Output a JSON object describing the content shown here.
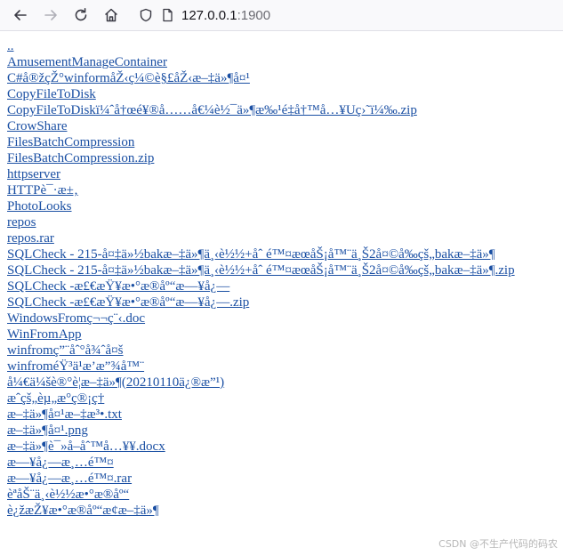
{
  "browser": {
    "url_host": "127.0.0.1",
    "url_port": ":1900"
  },
  "listing": {
    "parent": "..",
    "items": [
      "AmusementManageContainer",
      "C#å®žçŽ°winformåŽ‹ç¼©è§£åŽ‹æ–‡ä»¶å¤¹",
      "CopyFileToDisk",
      "CopyFileToDiskï¼ˆå†œé¥®å……å€¼è½¯ä»¶æ‰¹é‡å†™å…¥Uç›˜ï¼‰.zip",
      "CrowShare",
      "FilesBatchCompression",
      "FilesBatchCompression.zip",
      "httpserver",
      "HTTPè¯·æ±‚",
      "PhotoLooks",
      "repos",
      "repos.rar",
      "SQLCheck - 215-å¤‡ä»½bakæ–‡ä»¶ä¸‹è½½+åˆ é™¤æœåŠ¡å™¨ä¸Š2å¤©å‰çš„bakæ–‡ä»¶",
      "SQLCheck - 215-å¤‡ä»½bakæ–‡ä»¶ä¸‹è½½+åˆ é™¤æœåŠ¡å™¨ä¸Š2å¤©å‰çš„bakæ–‡ä»¶.zip",
      "SQLCheck -æ£€æŸ¥æ•°æ®åº“æ—¥å¿—",
      "SQLCheck -æ£€æŸ¥æ•°æ®åº“æ—¥å¿—.zip",
      "WindowsFromç¬¬ç¨‹.doc",
      "WinFromApp",
      "winfromç”¨åˆ°å¾ˆå¤š",
      "winfroméŸ³ä¹æ’­æ”¾å™¨",
      "å¼€ä¼šè®°è¦æ–‡ä»¶(20210110ä¿®æ”¹)",
      "æˆçš„èµ„æ°ç®¡ç†",
      "æ–‡ä»¶å¤¹æ–‡æ³•.txt",
      "æ–‡ä»¶å¤¹.png",
      "æ–‡ä»¶è¯»å–åˆ™å…¥¥.docx",
      "æ—¥å¿—æ¸…é™¤",
      "æ—¥å¿—æ¸…é™¤.rar",
      "èªåŠ¨ä¸‹è½½æ•°æ®åº“",
      "è¿žæŽ¥æ•°æ®åº“æ¢æ–‡ä»¶"
    ]
  },
  "watermark": "CSDN @不生产代码的码农",
  "colors": {
    "link": "#1a4fa3",
    "toolbar_bg": "#f9f9fb"
  }
}
